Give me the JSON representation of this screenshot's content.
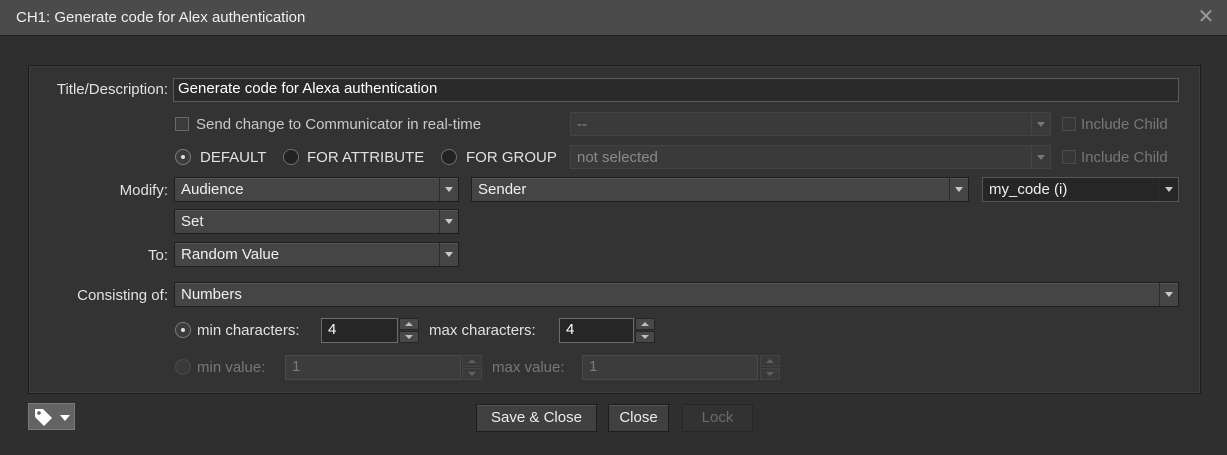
{
  "window": {
    "title": "CH1: Generate code for Alex authentication"
  },
  "form": {
    "title_label": "Title/Description:",
    "title_value": "Generate code for Alexa authentication",
    "send_change_label": "Send change to Communicator in real-time",
    "send_change_checked": false,
    "communicator_select": "--",
    "include_child_1": "Include Child",
    "radio_default": "DEFAULT",
    "radio_attribute": "FOR ATTRIBUTE",
    "radio_group": "FOR GROUP",
    "radio_selected": "DEFAULT",
    "group_select": "not selected",
    "include_child_2": "Include Child",
    "modify_label": "Modify:",
    "modify_1": "Audience",
    "modify_2": "Sender",
    "modify_3": "my_code (i)",
    "operation": "Set",
    "to_label": "To:",
    "to_value": "Random Value",
    "consisting_label": "Consisting of:",
    "consisting_value": "Numbers",
    "min_chars_label": "min characters:",
    "min_chars_value": "4",
    "max_chars_label": "max characters:",
    "max_chars_value": "4",
    "min_value_label": "min value:",
    "min_value_value": "1",
    "max_value_label": "max value:",
    "max_value_value": "1",
    "length_mode_selected": "min characters"
  },
  "footer": {
    "save_close": "Save & Close",
    "close": "Close",
    "lock": "Lock",
    "tag_menu_icon": "tag-icon"
  },
  "colors": {
    "background": "#2f2f2f",
    "titlebar": "#4b4b4b",
    "text": "#e2e2e2",
    "disabled_text": "#777777"
  }
}
